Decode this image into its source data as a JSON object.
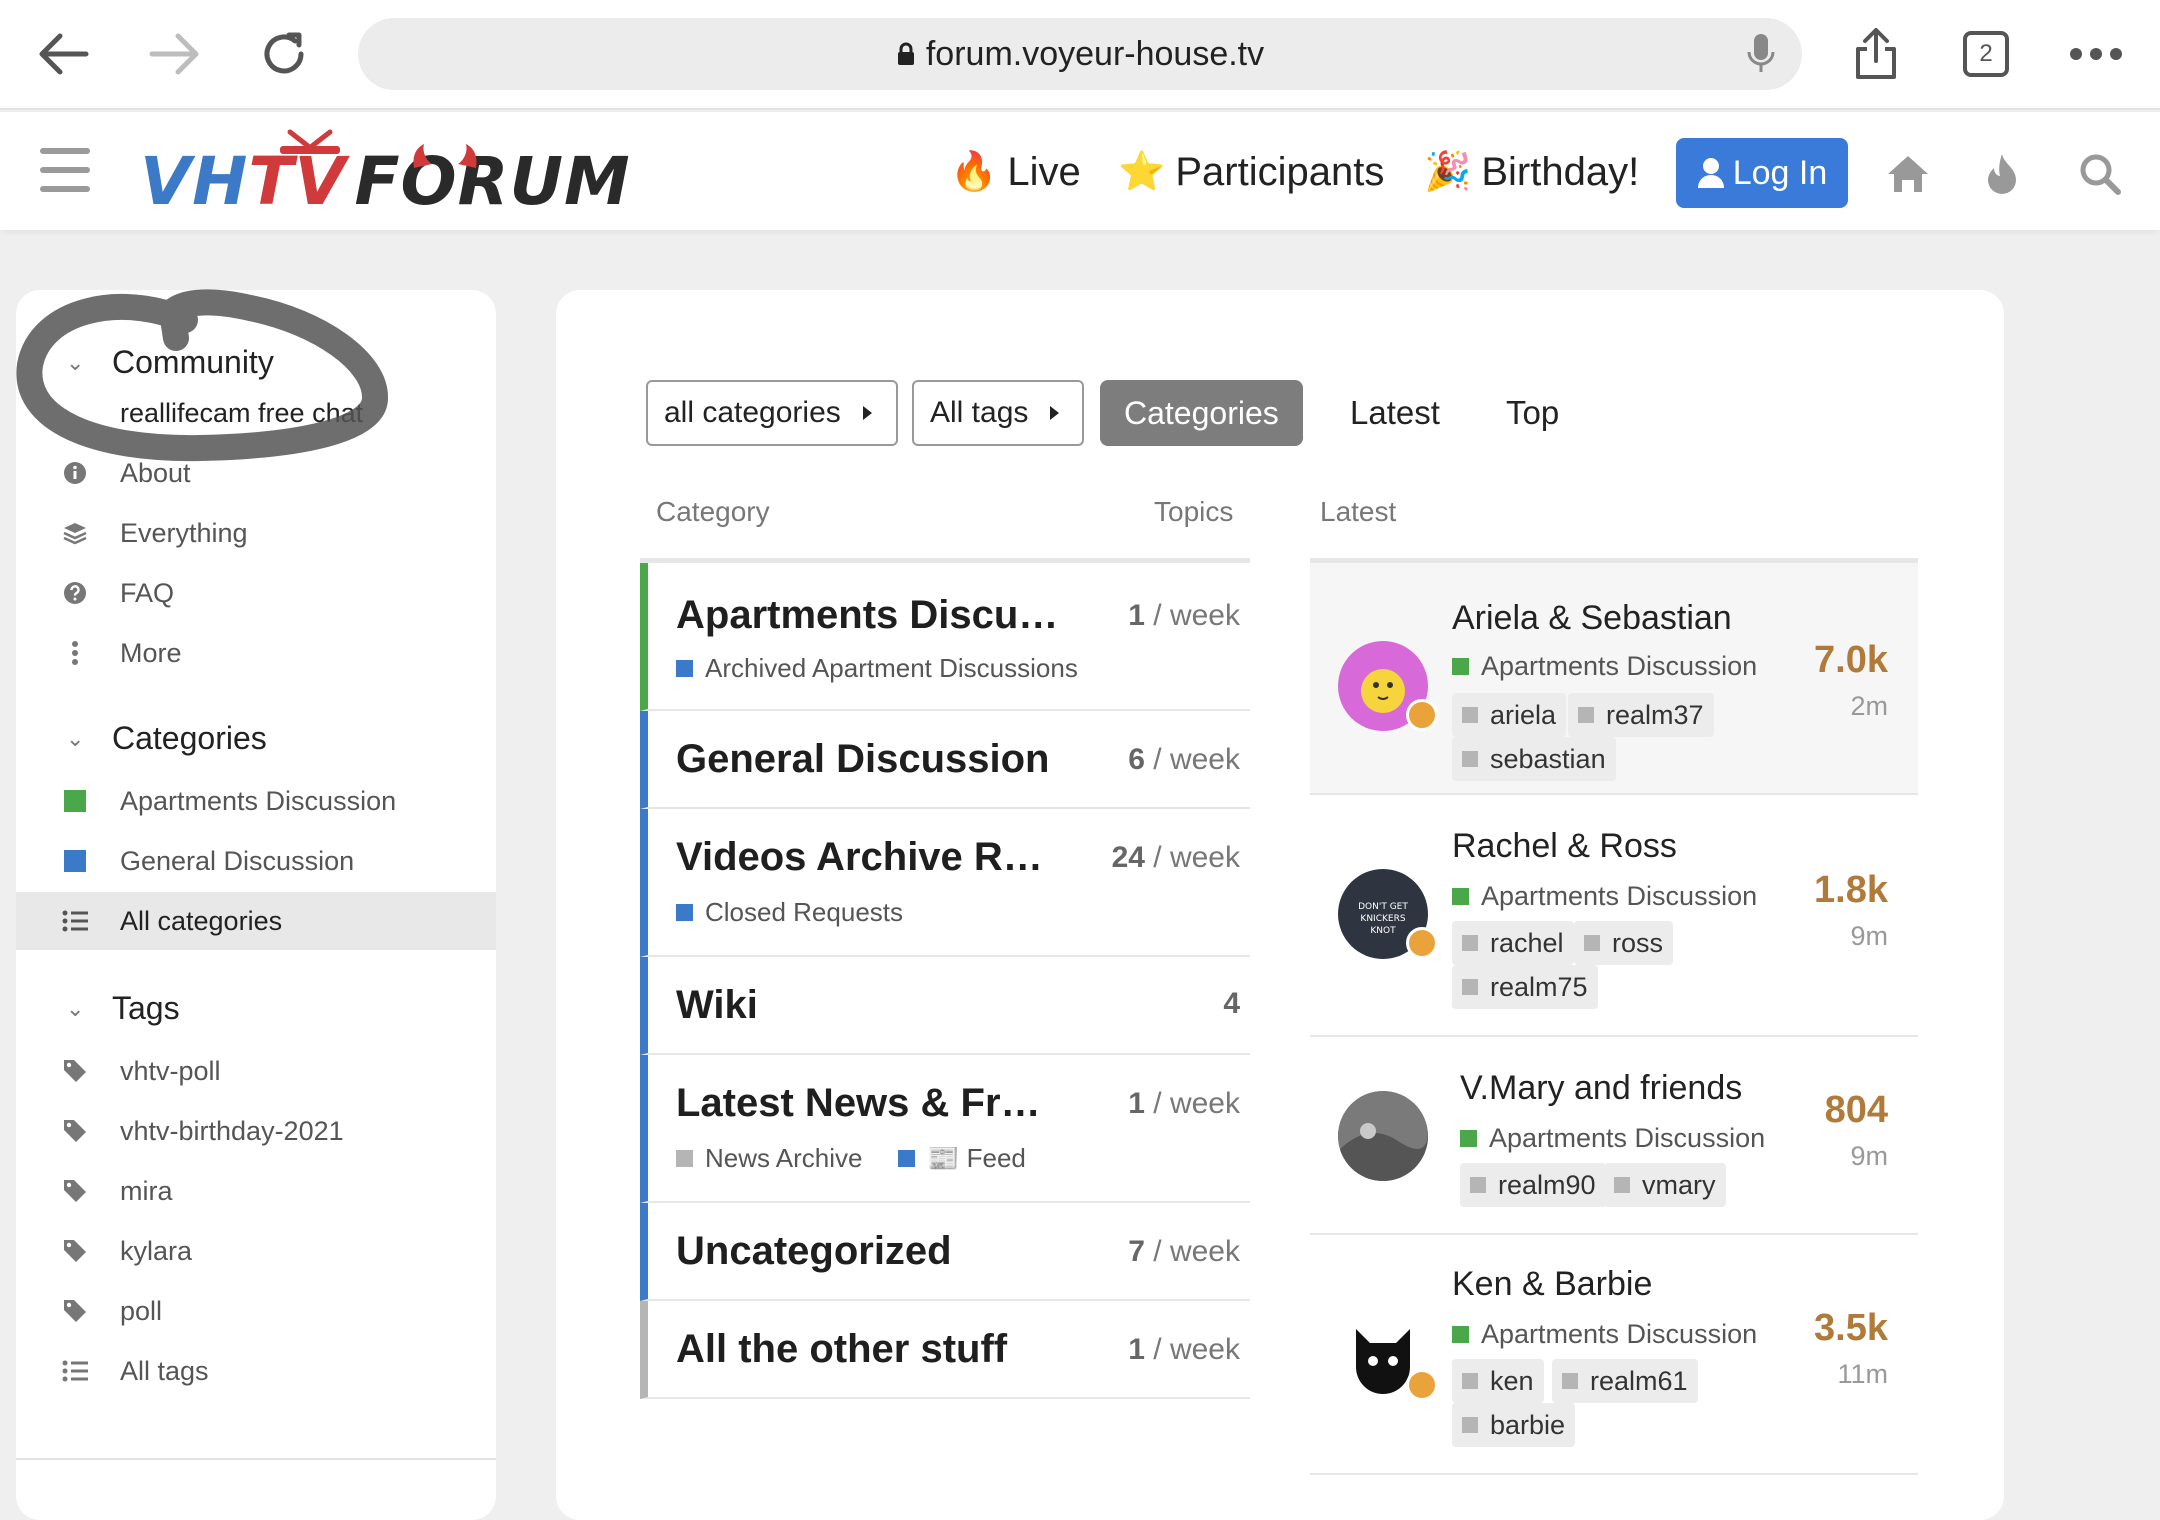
{
  "browser": {
    "url": "forum.voyeur-house.tv",
    "tab_count": "2"
  },
  "header": {
    "logo_vh": "VH",
    "logo_tv": "TV",
    "logo_forum": "FORUM",
    "nav": [
      {
        "emoji": "🔥",
        "label": "Live"
      },
      {
        "emoji": "⭐",
        "label": "Participants"
      },
      {
        "emoji": "🎉",
        "label": "Birthday!"
      }
    ],
    "login_label": "Log In"
  },
  "annotation": {
    "color": "#555555"
  },
  "sidebar": {
    "community": {
      "heading": "Community",
      "items": [
        {
          "label": "reallifecam free chat",
          "icon": "none"
        },
        {
          "label": "About",
          "icon": "info-icon"
        },
        {
          "label": "Everything",
          "icon": "layers-icon"
        },
        {
          "label": "FAQ",
          "icon": "question-icon"
        },
        {
          "label": "More",
          "icon": "more-vertical-icon"
        }
      ]
    },
    "categories": {
      "heading": "Categories",
      "items": [
        {
          "label": "Apartments Discussion",
          "color": "#4aa84a"
        },
        {
          "label": "General Discussion",
          "color": "#3a7ac8"
        },
        {
          "label": "All categories",
          "icon": "list-icon",
          "active": true
        }
      ]
    },
    "tags": {
      "heading": "Tags",
      "items": [
        {
          "label": "vhtv-poll"
        },
        {
          "label": "vhtv-birthday-2021"
        },
        {
          "label": "mira"
        },
        {
          "label": "kylara"
        },
        {
          "label": "poll"
        },
        {
          "label": "All tags",
          "icon": "list-icon"
        }
      ]
    }
  },
  "filters": {
    "all_categories": "all categories",
    "all_tags": "All tags",
    "tabs": [
      "Categories",
      "Latest",
      "Top"
    ],
    "selected_tab": "Categories"
  },
  "columns": {
    "category": "Category",
    "topics": "Topics",
    "latest": "Latest"
  },
  "categories": [
    {
      "name": "Apartments Discu…",
      "count": "1",
      "per": "/ week",
      "color": "#4aa84a",
      "subs": [
        {
          "label": "Archived Apartment Discussions",
          "color": "#3a7ac8"
        }
      ]
    },
    {
      "name": "General Discussion",
      "count": "6",
      "per": "/ week",
      "color": "#3a7ac8",
      "subs": []
    },
    {
      "name": "Videos Archive R…",
      "count": "24",
      "per": "/ week",
      "color": "#3a7ac8",
      "subs": [
        {
          "label": "Closed Requests",
          "color": "#3a7ac8"
        }
      ]
    },
    {
      "name": "Wiki",
      "count": "4",
      "per": "",
      "color": "#3a7ac8",
      "subs": []
    },
    {
      "name": "Latest News & Fr…",
      "count": "1",
      "per": "/ week",
      "color": "#3a7ac8",
      "subs": [
        {
          "label": "News Archive",
          "color": "#b5b5b5"
        },
        {
          "label": "📰 Feed",
          "color": "#3a7ac8"
        }
      ]
    },
    {
      "name": "Uncategorized",
      "count": "7",
      "per": "/ week",
      "color": "#3a7ac8",
      "subs": []
    },
    {
      "name": "All the other stuff",
      "count": "1",
      "per": "/ week",
      "color": "#b5b5b5",
      "subs": []
    }
  ],
  "topics": [
    {
      "title": "Ariela & Sebastian",
      "category": "Apartments Discussion",
      "tags": [
        "ariela",
        "realm37",
        "sebastian"
      ],
      "views": "7.0k",
      "ago": "2m"
    },
    {
      "title": "Rachel & Ross",
      "category": "Apartments Discussion",
      "tags": [
        "rachel",
        "ross",
        "realm75"
      ],
      "views": "1.8k",
      "ago": "9m"
    },
    {
      "title": "V.Mary and friends",
      "category": "Apartments Discussion",
      "tags": [
        "realm90",
        "vmary"
      ],
      "views": "804",
      "ago": "9m"
    },
    {
      "title": "Ken & Barbie",
      "category": "Apartments Discussion",
      "tags": [
        "ken",
        "realm61",
        "barbie"
      ],
      "views": "3.5k",
      "ago": "11m"
    }
  ]
}
